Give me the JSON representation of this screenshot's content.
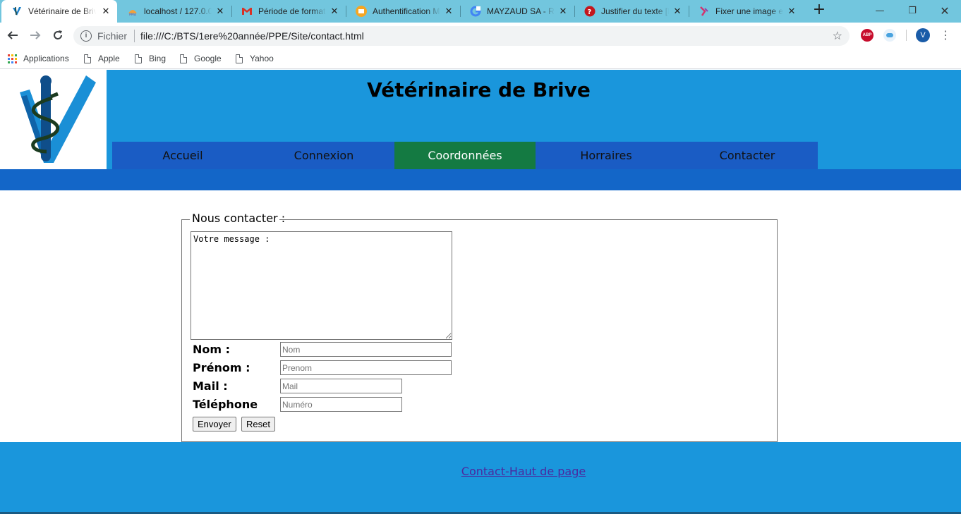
{
  "browser": {
    "tabs": [
      {
        "title": "Vétérinaire de Brive",
        "icon": "vet-logo-icon",
        "active": true
      },
      {
        "title": "localhost / 127.0.0.1",
        "icon": "phpmyadmin-icon",
        "active": false
      },
      {
        "title": "Période de formation",
        "icon": "gmail-icon",
        "active": false
      },
      {
        "title": "Authentification MS",
        "icon": "mail-icon",
        "active": false
      },
      {
        "title": "MAYZAUD SA - Re",
        "icon": "google-icon",
        "active": false
      },
      {
        "title": "Justifier du texte [F",
        "icon": "question-icon",
        "active": false
      },
      {
        "title": "Fixer une image en",
        "icon": "bookmark-icon",
        "active": false
      }
    ],
    "address": {
      "scheme_label": "Fichier",
      "url": "file:///C:/BTS/1ere%20année/PPE/Site/contact.html"
    },
    "bookmarks": [
      "Applications",
      "Apple",
      "Bing",
      "Google",
      "Yahoo"
    ],
    "profile_initial": "V",
    "abp_label": "ABP"
  },
  "site": {
    "title": "Vétérinaire de Brive",
    "nav": [
      "Accueil",
      "Connexion",
      "Coordonnées",
      "Horraires",
      "Contacter"
    ],
    "current_nav": "Coordonnées",
    "colors": {
      "header": "#1a96dc",
      "nav": "#1a5cc4",
      "nav_active": "#147a42",
      "band": "#1366c8"
    }
  },
  "form": {
    "legend": "Nous contacter :",
    "message_value": "Votre message :",
    "fields": [
      {
        "label": "Nom :",
        "placeholder": "Nom"
      },
      {
        "label": "Prénom :",
        "placeholder": "Prenom"
      },
      {
        "label": "Mail :",
        "placeholder": "Mail"
      },
      {
        "label": "Téléphone",
        "placeholder": "Numéro"
      }
    ],
    "submit_label": "Envoyer",
    "reset_label": "Reset"
  },
  "footer": {
    "contact_link": "Contact",
    "top_link": "-Haut de page"
  }
}
